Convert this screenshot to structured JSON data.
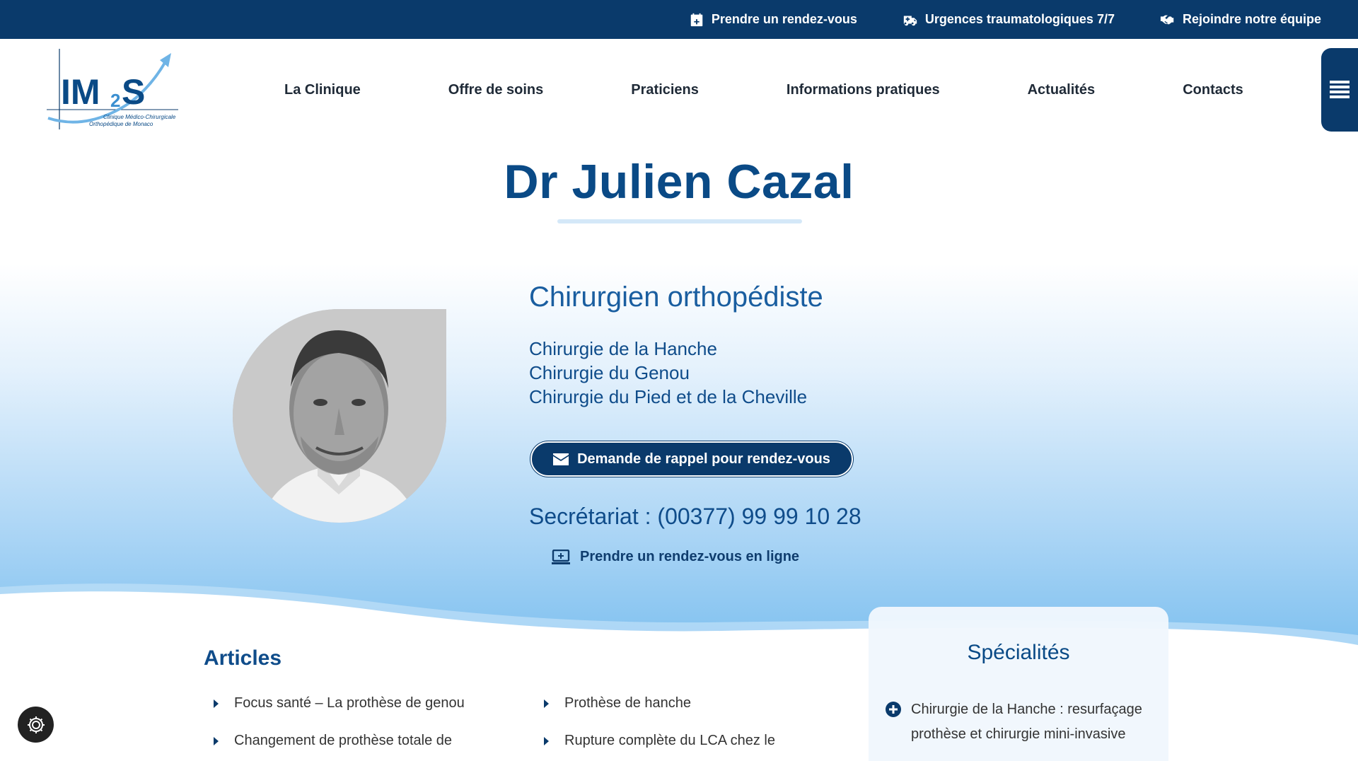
{
  "topbar": {
    "appointment": "Prendre un rendez-vous",
    "emergency": "Urgences traumatologiques 7/7",
    "join": "Rejoindre notre équipe"
  },
  "logo": {
    "brand": "IM2S",
    "tagline_line1": "Clinique Médico-Chirurgicale",
    "tagline_line2": "Orthopédique de Monaco"
  },
  "nav": {
    "items": [
      {
        "label": "La Clinique"
      },
      {
        "label": "Offre de soins"
      },
      {
        "label": "Praticiens"
      },
      {
        "label": "Informations pratiques"
      },
      {
        "label": "Actualités"
      },
      {
        "label": "Contacts"
      }
    ]
  },
  "doctor": {
    "name": "Dr Julien Cazal",
    "specialty": "Chirurgien orthopédiste",
    "areas": [
      "Chirurgie de la Hanche",
      "Chirurgie du Genou",
      "Chirurgie du Pied et de la Cheville"
    ],
    "callback_label": "Demande de rappel pour rendez-vous",
    "secretariat": "Secrétariat : (00377) 99 99 10 28",
    "online_label": "Prendre un rendez-vous en ligne"
  },
  "articles": {
    "title": "Articles",
    "col1": [
      "Focus santé – La prothèse de genou",
      "Changement de prothèse totale de"
    ],
    "col2": [
      "Prothèse de hanche",
      "Rupture complète du LCA chez le"
    ]
  },
  "specialites": {
    "title": "Spécialités",
    "items": [
      "Chirurgie de la Hanche : resurfaçage prothèse et chirurgie mini-invasive"
    ]
  },
  "colors": {
    "navy": "#0a3a6b",
    "title_blue": "#0a4a86",
    "text_blue": "#0f4c8a"
  }
}
